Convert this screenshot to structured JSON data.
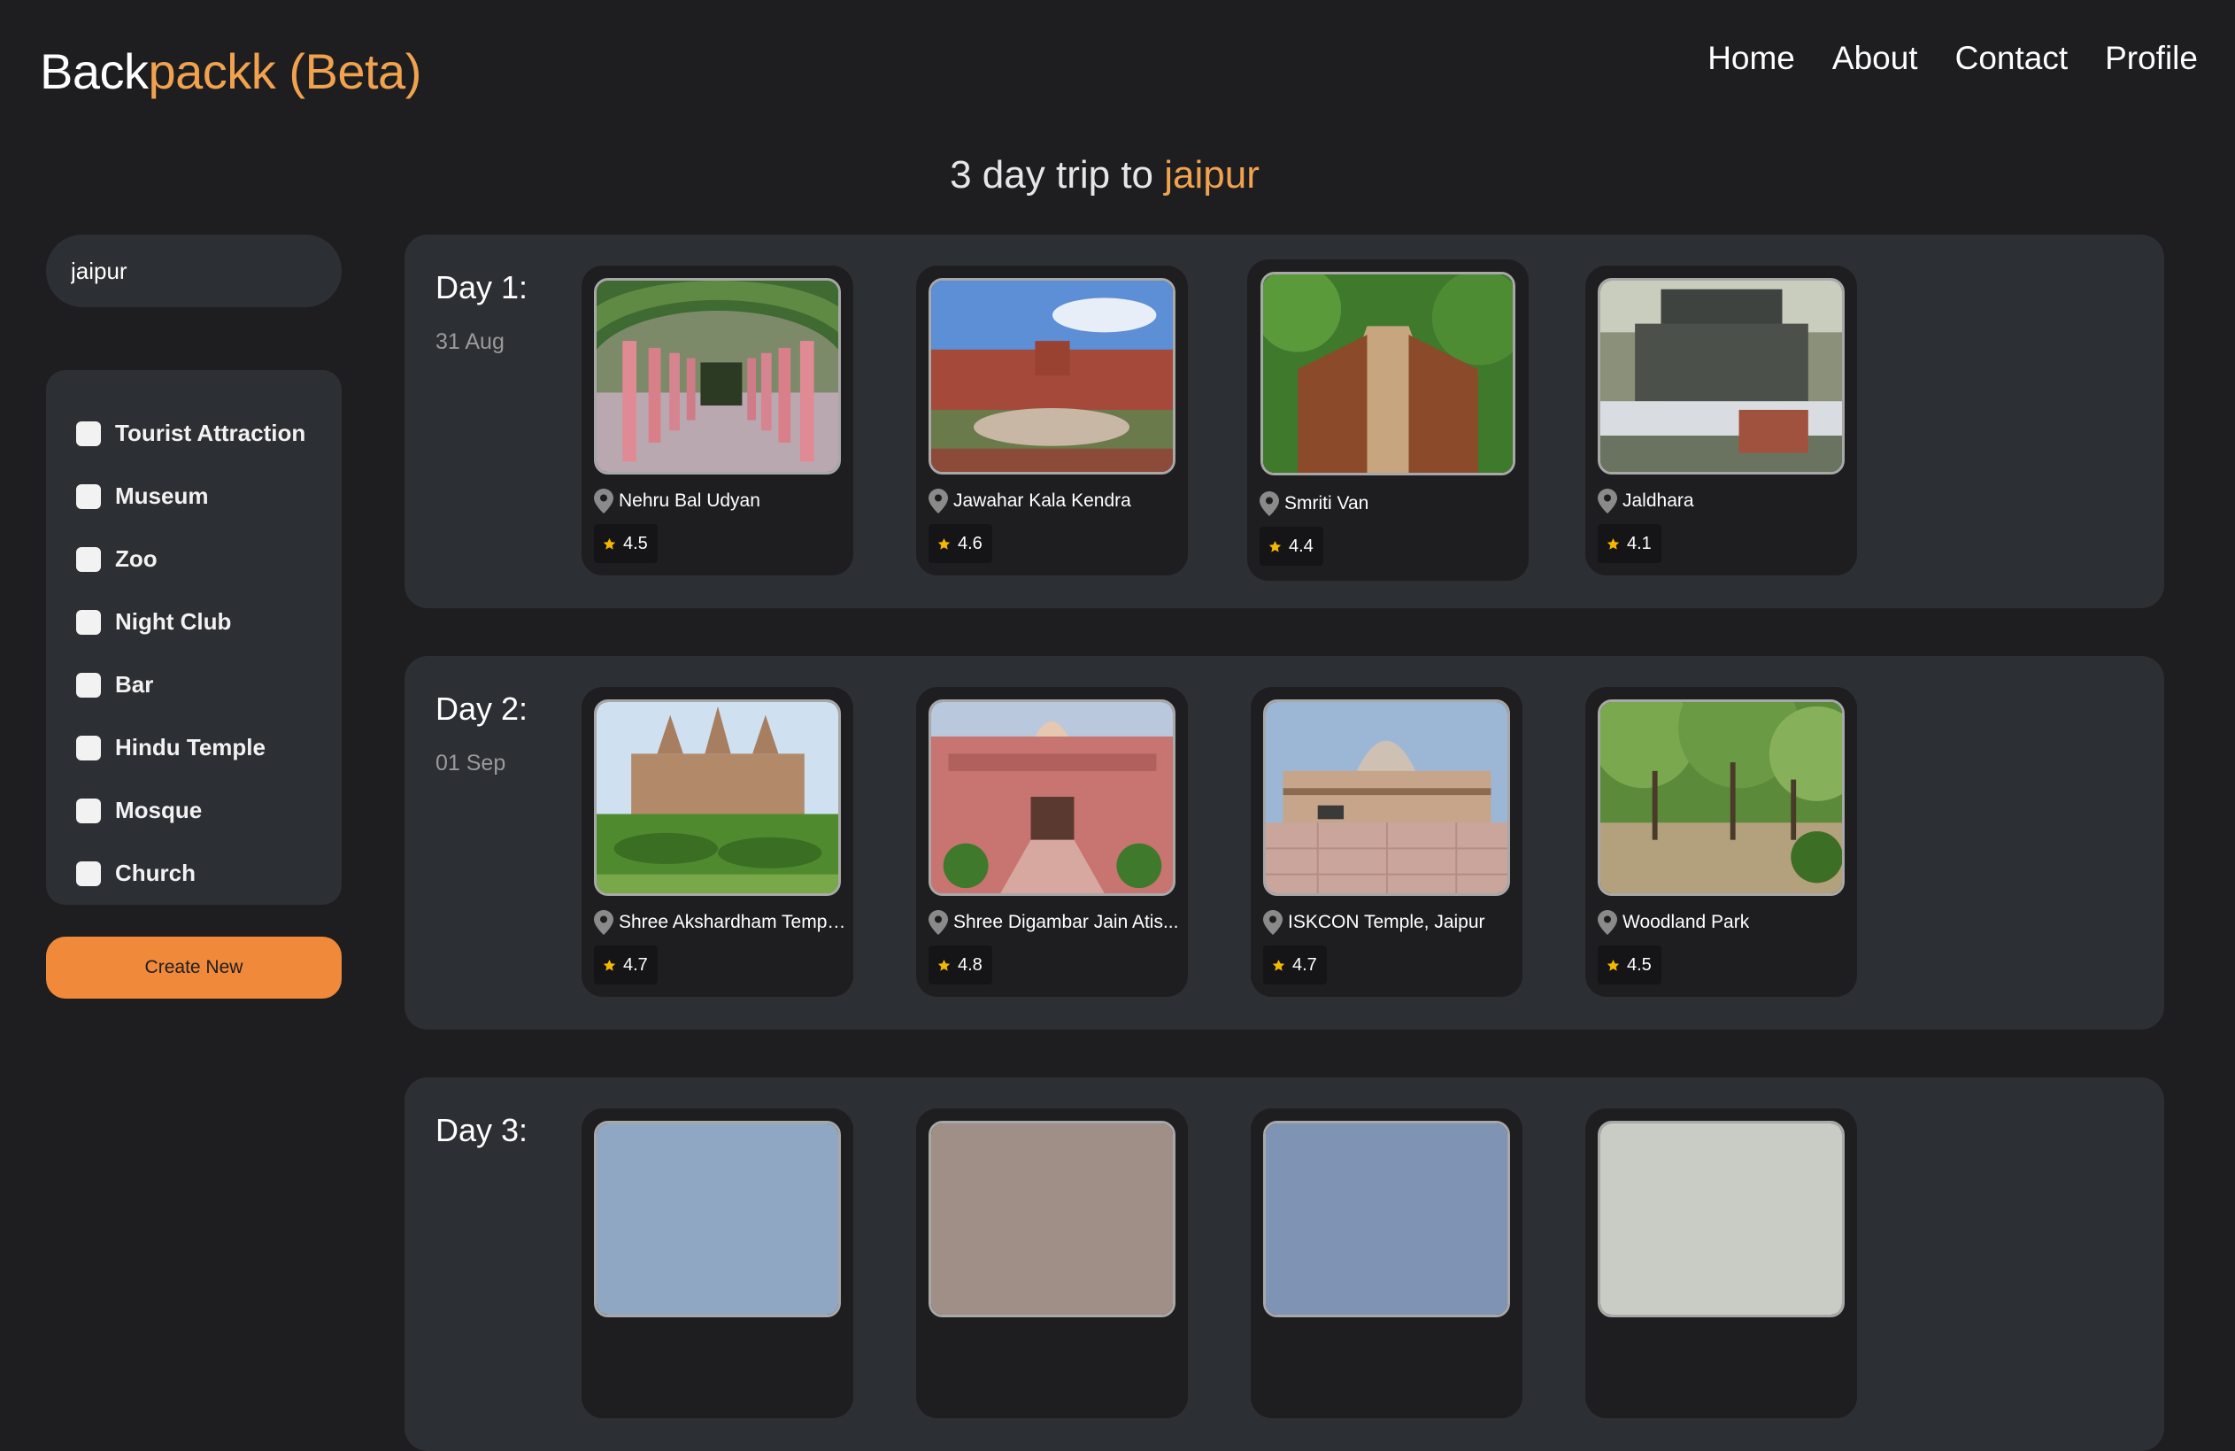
{
  "header": {
    "logo_part1": "Back",
    "logo_part2": "packk (Beta)",
    "nav": [
      "Home",
      "About",
      "Contact",
      "Profile"
    ]
  },
  "trip": {
    "title_prefix": "3 day trip to ",
    "city": "jaipur"
  },
  "sidebar": {
    "search_value": "jaipur",
    "filters": [
      "Tourist Attraction",
      "Museum",
      "Zoo",
      "Night Club",
      "Bar",
      "Hindu Temple",
      "Mosque",
      "Church"
    ],
    "create_label": "Create New"
  },
  "days": [
    {
      "title": "Day 1:",
      "date": "31 Aug",
      "places": [
        {
          "name": "Nehru Bal Udyan",
          "rating": "4.5"
        },
        {
          "name": "Jawahar Kala Kendra",
          "rating": "4.6"
        },
        {
          "name": "Smriti Van",
          "rating": "4.4"
        },
        {
          "name": "Jaldhara",
          "rating": "4.1"
        }
      ]
    },
    {
      "title": "Day 2:",
      "date": "01 Sep",
      "places": [
        {
          "name": "Shree Akshardham Templ...",
          "rating": "4.7"
        },
        {
          "name": "Shree Digambar Jain Atis...",
          "rating": "4.8"
        },
        {
          "name": "ISKCON Temple, Jaipur",
          "rating": "4.7"
        },
        {
          "name": "Woodland Park",
          "rating": "4.5"
        }
      ]
    },
    {
      "title": "Day 3:"
    }
  ],
  "colors": {
    "accent": "#f0a24e",
    "button": "#f0893a",
    "panel": "#2c2f34",
    "background": "#1e1e20",
    "star": "#f5b800"
  },
  "icons": {
    "place": "location-pin-icon",
    "rating": "star-icon"
  }
}
